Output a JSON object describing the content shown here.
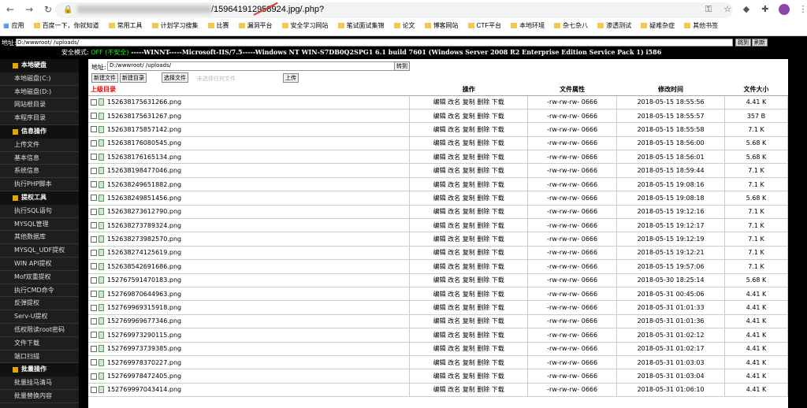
{
  "browser": {
    "url_visible": "/159641912958924.jpg/.php?",
    "bookmarks": [
      "应用",
      "百度一下，你就知道",
      "常用工具",
      "计划学习搜集",
      "比赛",
      "漏洞平台",
      "安全学习网站",
      "笔试面试集锦",
      "论文",
      "博客网站",
      "CTF平台",
      "本地环境",
      "杂七杂八",
      "渗透测试",
      "疑难杂症",
      "其他书签"
    ]
  },
  "addr": {
    "label": "地址:",
    "value": "D:/wwwroot/                        /uploads/",
    "go": "跳到",
    "refresh": "刷新"
  },
  "secure_line": {
    "label": "安全模式:",
    "mode": "OFF (不安全)",
    "os": "-----WINNT-----Microsoft-IIS/7.5-----Windows NT WIN-S7DB0Q2SPG1 6.1 build 7601 (Windows Server 2008 R2 Enterprise Edition Service Pack 1) i586"
  },
  "sidebar": {
    "items": [
      {
        "type": "header",
        "label": "本地硬盘"
      },
      {
        "type": "item",
        "label": "本地磁盘(C:)"
      },
      {
        "type": "item",
        "label": "本地磁盘(D:)"
      },
      {
        "type": "item",
        "label": "网站根目录"
      },
      {
        "type": "item",
        "label": "本程序目录"
      },
      {
        "type": "header",
        "label": "信息操作"
      },
      {
        "type": "item",
        "label": "上传文件"
      },
      {
        "type": "item",
        "label": "基本信息"
      },
      {
        "type": "item",
        "label": "系统信息"
      },
      {
        "type": "item",
        "label": "执行PHP脚本"
      },
      {
        "type": "header",
        "label": "提权工具"
      },
      {
        "type": "item",
        "label": "执行SQL语句"
      },
      {
        "type": "item",
        "label": "MYSQL管理"
      },
      {
        "type": "item",
        "label": "其他数据库"
      },
      {
        "type": "item",
        "label": "MYSQL_UDF提权"
      },
      {
        "type": "item",
        "label": "WIN API提权"
      },
      {
        "type": "item",
        "label": "Mof双重提权"
      },
      {
        "type": "item",
        "label": "执行CMD命令"
      },
      {
        "type": "item",
        "label": "反弹提权"
      },
      {
        "type": "item",
        "label": "Serv-U提权"
      },
      {
        "type": "item",
        "label": "低权限读root密码"
      },
      {
        "type": "item",
        "label": "文件下载"
      },
      {
        "type": "item",
        "label": "端口扫描"
      },
      {
        "type": "header",
        "label": "批量操作"
      },
      {
        "type": "item",
        "label": "批量挂马清马"
      },
      {
        "type": "item",
        "label": "批量替换内容"
      }
    ]
  },
  "main": {
    "addr_label": "地址:",
    "addr_value": "D:/wwwroot/                    /uploads/",
    "goto": "转到",
    "btn_newfile": "新建文件",
    "btn_newdir": "新建目录",
    "btn_choose": "选择文件",
    "choose_placeholder": "未选择任何文件",
    "btn_upload": "上传",
    "headers": [
      "上级目录",
      "操作",
      "文件属性",
      "修改时间",
      "文件大小"
    ],
    "actions": "编辑 改名 复制 删除 下载",
    "rows": [
      {
        "name": "152638175631266.png",
        "attr": "-rw-rw-rw- 0666",
        "time": "2018-05-15 18:55:56",
        "size": "4.41 K"
      },
      {
        "name": "152638175631267.png",
        "attr": "-rw-rw-rw- 0666",
        "time": "2018-05-15 18:55:57",
        "size": "357 B"
      },
      {
        "name": "152638175857142.png",
        "attr": "-rw-rw-rw- 0666",
        "time": "2018-05-15 18:55:58",
        "size": "7.1 K"
      },
      {
        "name": "152638176080545.png",
        "attr": "-rw-rw-rw- 0666",
        "time": "2018-05-15 18:56:00",
        "size": "5.68 K"
      },
      {
        "name": "152638176165134.png",
        "attr": "-rw-rw-rw- 0666",
        "time": "2018-05-15 18:56:01",
        "size": "5.68 K"
      },
      {
        "name": "152638198477046.png",
        "attr": "-rw-rw-rw- 0666",
        "time": "2018-05-15 18:59:44",
        "time2": "",
        "size": "7.1 K"
      },
      {
        "name": "152638249651882.png",
        "attr": "-rw-rw-rw- 0666",
        "time": "2018-05-15 19:08:16",
        "size": "7.1 K"
      },
      {
        "name": "152638249851456.png",
        "attr": "-rw-rw-rw- 0666",
        "time": "2018-05-15 19:08:18",
        "size": "5.68 K"
      },
      {
        "name": "152638273612790.png",
        "attr": "-rw-rw-rw- 0666",
        "time": "2018-05-15 19:12:16",
        "size": "7.1 K"
      },
      {
        "name": "152638273789324.png",
        "attr": "-rw-rw-rw- 0666",
        "time": "2018-05-15 19:12:17",
        "size": "7.1 K"
      },
      {
        "name": "152638273982570.png",
        "attr": "-rw-rw-rw- 0666",
        "time": "2018-05-15 19:12:19",
        "size": "7.1 K"
      },
      {
        "name": "152638274125619.png",
        "attr": "-rw-rw-rw- 0666",
        "time": "2018-05-15 19:12:21",
        "size": "7.1 K"
      },
      {
        "name": "152638542691686.png",
        "attr": "-rw-rw-rw- 0666",
        "time": "2018-05-15 19:57:06",
        "size": "7.1 K"
      },
      {
        "name": "152767591470183.png",
        "attr": "-rw-rw-rw- 0666",
        "time": "2018-05-30 18:25:14",
        "size": "5.68 K"
      },
      {
        "name": "152769870644963.png",
        "attr": "-rw-rw-rw- 0666",
        "time": "2018-05-31 00:45:06",
        "size": "4.41 K"
      },
      {
        "name": "152769969315918.png",
        "attr": "-rw-rw-rw- 0666",
        "time": "2018-05-31 01:01:33",
        "size": "4.41 K"
      },
      {
        "name": "152769969677346.png",
        "attr": "-rw-rw-rw- 0666",
        "time": "2018-05-31 01:01:36",
        "size": "4.41 K"
      },
      {
        "name": "152769973290115.png",
        "attr": "-rw-rw-rw- 0666",
        "time": "2018-05-31 01:02:12",
        "size": "4.41 K"
      },
      {
        "name": "152769973739385.png",
        "attr": "-rw-rw-rw- 0666",
        "time": "2018-05-31 01:02:17",
        "size": "4.41 K"
      },
      {
        "name": "152769978370227.png",
        "attr": "-rw-rw-rw- 0666",
        "time": "2018-05-31 01:03:03",
        "size": "4.41 K"
      },
      {
        "name": "152769978472405.png",
        "attr": "-rw-rw-rw- 0666",
        "time": "2018-05-31 01:03:04",
        "size": "4.41 K"
      },
      {
        "name": "152769997043414.png",
        "attr": "-rw-rw-rw- 0666",
        "time": "2018-05-31 01:06:10",
        "size": "4.41 K"
      }
    ]
  }
}
